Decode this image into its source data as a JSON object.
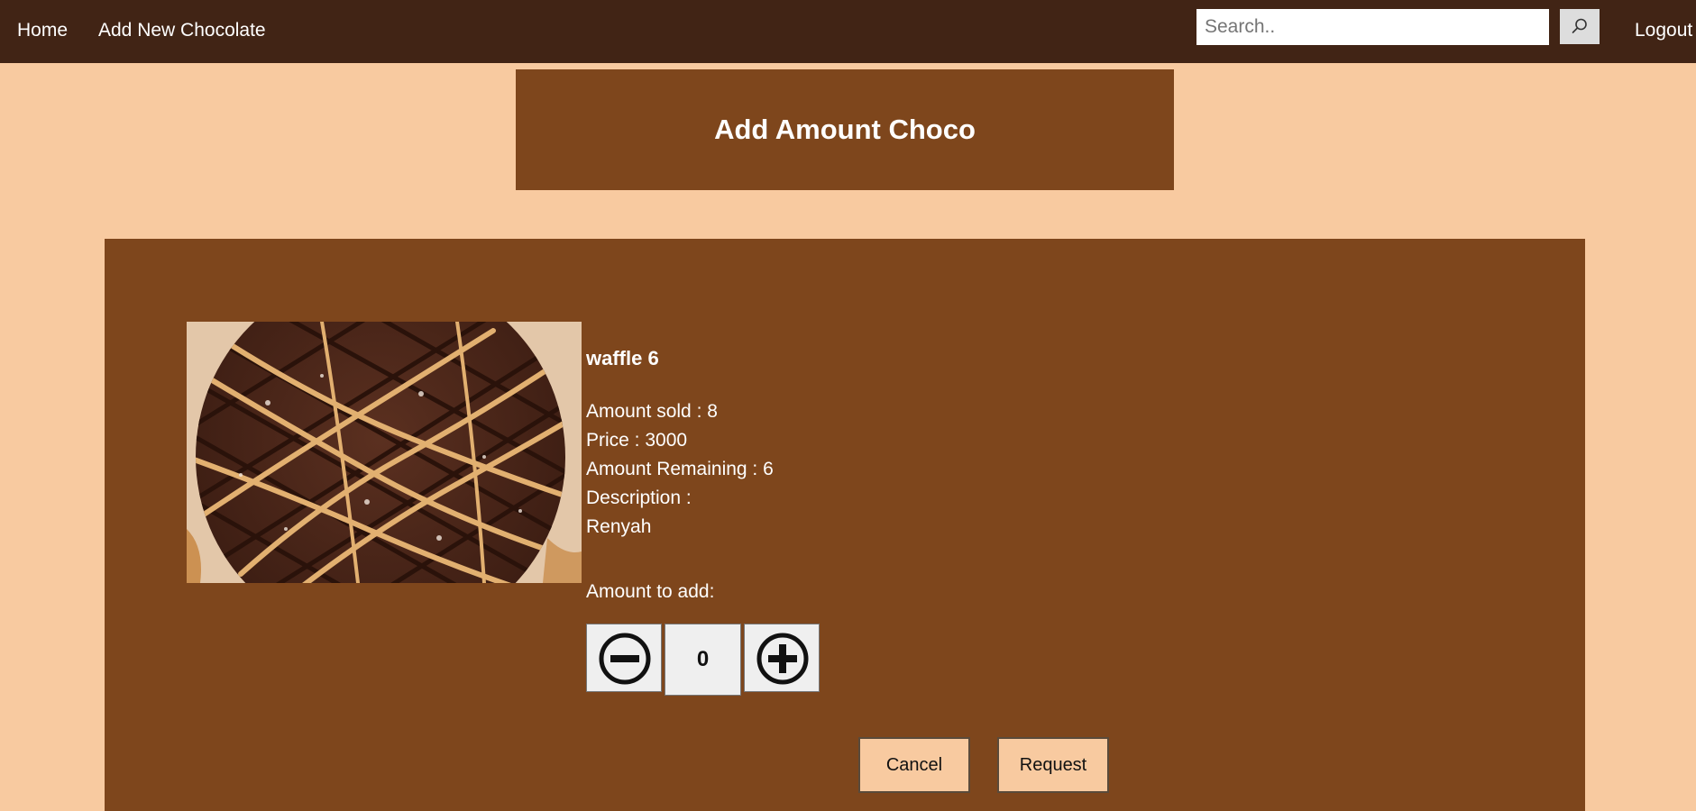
{
  "navbar": {
    "home_label": "Home",
    "add_label": "Add New Chocolate",
    "logout_label": "Logout",
    "search": {
      "placeholder": "Search..",
      "value": "",
      "button_icon": "search-icon"
    }
  },
  "page": {
    "title": "Add Amount Choco"
  },
  "product": {
    "name": "waffle 6",
    "image": "chocolate-waffle-with-caramel-drizzle",
    "amount_sold": "Amount sold : 8",
    "price": "Price : 3000",
    "amount_remaining": "Amount Remaining : 6",
    "description_label": "Description :",
    "description": "Renyah"
  },
  "stepper": {
    "label": "Amount to add:",
    "value": "0",
    "minus_icon": "minus-circle-icon",
    "plus_icon": "plus-circle-icon"
  },
  "actions": {
    "cancel_label": "Cancel",
    "request_label": "Request"
  },
  "colors": {
    "navbar": "#412415",
    "background": "#f8caa0",
    "panel": "#7e461c",
    "button": "#f8caa0"
  }
}
